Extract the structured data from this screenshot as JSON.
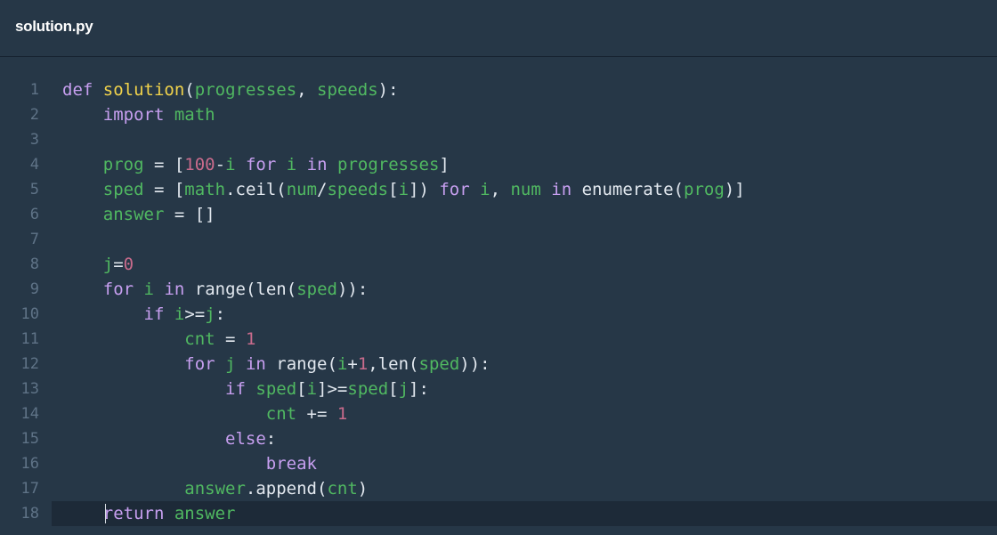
{
  "header": {
    "file_name": "solution.py"
  },
  "editor": {
    "active_line": 18,
    "colors": {
      "background": "#263747",
      "active_line": "#1d2a38",
      "keyword": "#c79ff0",
      "function": "#f1d34b",
      "variable": "#50b861",
      "number": "#c96b8c",
      "plain": "#e2e8ef",
      "line_number": "#5f7387"
    },
    "lines": [
      {
        "num": "1",
        "tokens": [
          {
            "t": "def",
            "c": "kw"
          },
          {
            "t": " "
          },
          {
            "t": "solution",
            "c": "fn"
          },
          {
            "t": "("
          },
          {
            "t": "progresses",
            "c": "v"
          },
          {
            "t": ", "
          },
          {
            "t": "speeds",
            "c": "v"
          },
          {
            "t": "):"
          }
        ]
      },
      {
        "num": "2",
        "tokens": [
          {
            "t": "    "
          },
          {
            "t": "import",
            "c": "kw"
          },
          {
            "t": " "
          },
          {
            "t": "math",
            "c": "v"
          }
        ]
      },
      {
        "num": "3",
        "tokens": []
      },
      {
        "num": "4",
        "tokens": [
          {
            "t": "    "
          },
          {
            "t": "prog",
            "c": "v"
          },
          {
            "t": " = ["
          },
          {
            "t": "100",
            "c": "n"
          },
          {
            "t": "-"
          },
          {
            "t": "i",
            "c": "v"
          },
          {
            "t": " "
          },
          {
            "t": "for",
            "c": "kw"
          },
          {
            "t": " "
          },
          {
            "t": "i",
            "c": "v"
          },
          {
            "t": " "
          },
          {
            "t": "in",
            "c": "kw"
          },
          {
            "t": " "
          },
          {
            "t": "progresses",
            "c": "v"
          },
          {
            "t": "]"
          }
        ]
      },
      {
        "num": "5",
        "tokens": [
          {
            "t": "    "
          },
          {
            "t": "sped",
            "c": "v"
          },
          {
            "t": " = ["
          },
          {
            "t": "math",
            "c": "v"
          },
          {
            "t": ".ceil("
          },
          {
            "t": "num",
            "c": "v"
          },
          {
            "t": "/"
          },
          {
            "t": "speeds",
            "c": "v"
          },
          {
            "t": "["
          },
          {
            "t": "i",
            "c": "v"
          },
          {
            "t": "]) "
          },
          {
            "t": "for",
            "c": "kw"
          },
          {
            "t": " "
          },
          {
            "t": "i",
            "c": "v"
          },
          {
            "t": ", "
          },
          {
            "t": "num",
            "c": "v"
          },
          {
            "t": " "
          },
          {
            "t": "in",
            "c": "kw"
          },
          {
            "t": " enumerate("
          },
          {
            "t": "prog",
            "c": "v"
          },
          {
            "t": ")]"
          }
        ]
      },
      {
        "num": "6",
        "tokens": [
          {
            "t": "    "
          },
          {
            "t": "answer",
            "c": "v"
          },
          {
            "t": " = []"
          }
        ]
      },
      {
        "num": "7",
        "tokens": []
      },
      {
        "num": "8",
        "tokens": [
          {
            "t": "    "
          },
          {
            "t": "j",
            "c": "v"
          },
          {
            "t": "="
          },
          {
            "t": "0",
            "c": "n"
          }
        ]
      },
      {
        "num": "9",
        "tokens": [
          {
            "t": "    "
          },
          {
            "t": "for",
            "c": "kw"
          },
          {
            "t": " "
          },
          {
            "t": "i",
            "c": "v"
          },
          {
            "t": " "
          },
          {
            "t": "in",
            "c": "kw"
          },
          {
            "t": " range(len("
          },
          {
            "t": "sped",
            "c": "v"
          },
          {
            "t": ")):"
          }
        ]
      },
      {
        "num": "10",
        "tokens": [
          {
            "t": "        "
          },
          {
            "t": "if",
            "c": "kw"
          },
          {
            "t": " "
          },
          {
            "t": "i",
            "c": "v"
          },
          {
            "t": ">="
          },
          {
            "t": "j",
            "c": "v"
          },
          {
            "t": ":"
          }
        ]
      },
      {
        "num": "11",
        "tokens": [
          {
            "t": "            "
          },
          {
            "t": "cnt",
            "c": "v"
          },
          {
            "t": " = "
          },
          {
            "t": "1",
            "c": "n"
          }
        ]
      },
      {
        "num": "12",
        "tokens": [
          {
            "t": "            "
          },
          {
            "t": "for",
            "c": "kw"
          },
          {
            "t": " "
          },
          {
            "t": "j",
            "c": "v"
          },
          {
            "t": " "
          },
          {
            "t": "in",
            "c": "kw"
          },
          {
            "t": " range("
          },
          {
            "t": "i",
            "c": "v"
          },
          {
            "t": "+"
          },
          {
            "t": "1",
            "c": "n"
          },
          {
            "t": ",len("
          },
          {
            "t": "sped",
            "c": "v"
          },
          {
            "t": ")):"
          }
        ]
      },
      {
        "num": "13",
        "tokens": [
          {
            "t": "                "
          },
          {
            "t": "if",
            "c": "kw"
          },
          {
            "t": " "
          },
          {
            "t": "sped",
            "c": "v"
          },
          {
            "t": "["
          },
          {
            "t": "i",
            "c": "v"
          },
          {
            "t": "]>="
          },
          {
            "t": "sped",
            "c": "v"
          },
          {
            "t": "["
          },
          {
            "t": "j",
            "c": "v"
          },
          {
            "t": "]:"
          }
        ]
      },
      {
        "num": "14",
        "tokens": [
          {
            "t": "                    "
          },
          {
            "t": "cnt",
            "c": "v"
          },
          {
            "t": " += "
          },
          {
            "t": "1",
            "c": "n"
          }
        ]
      },
      {
        "num": "15",
        "tokens": [
          {
            "t": "                "
          },
          {
            "t": "else",
            "c": "kw"
          },
          {
            "t": ":"
          }
        ]
      },
      {
        "num": "16",
        "tokens": [
          {
            "t": "                    "
          },
          {
            "t": "break",
            "c": "kw"
          }
        ]
      },
      {
        "num": "17",
        "tokens": [
          {
            "t": "            "
          },
          {
            "t": "answer",
            "c": "v"
          },
          {
            "t": ".append("
          },
          {
            "t": "cnt",
            "c": "v"
          },
          {
            "t": ")"
          }
        ]
      },
      {
        "num": "18",
        "tokens": [
          {
            "t": "    "
          },
          {
            "t": "return",
            "c": "kw"
          },
          {
            "t": " "
          },
          {
            "t": "answer",
            "c": "v"
          }
        ]
      }
    ]
  }
}
